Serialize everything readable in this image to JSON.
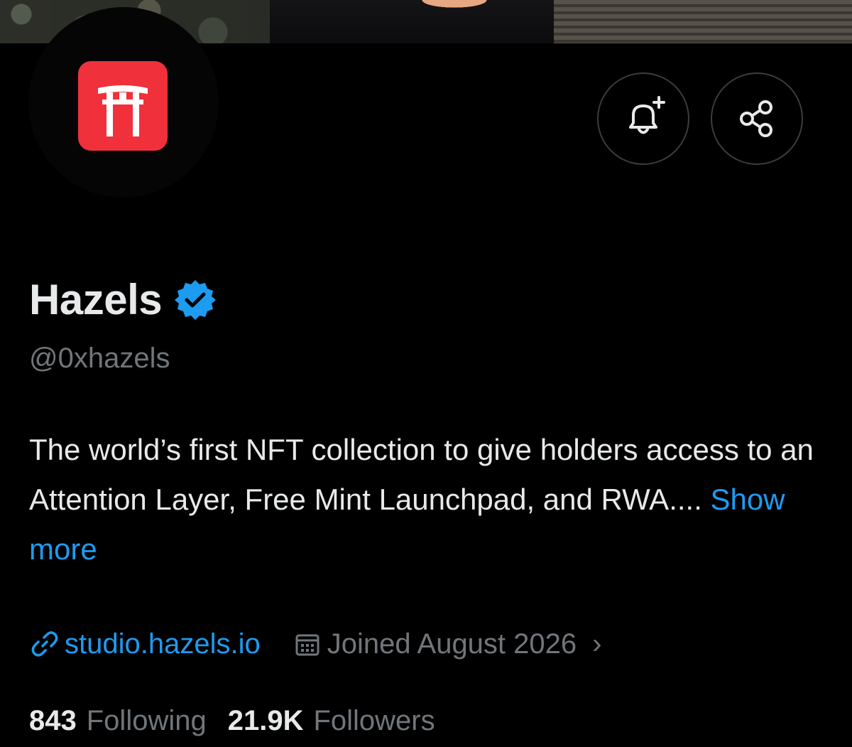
{
  "profile": {
    "display_name": "Hazels",
    "handle": "@0xhazels",
    "verified": true,
    "bio_text": "The world’s first NFT collection to give holders access to an Attention Layer, Free Mint Launchpad, and RWA....",
    "show_more_label": "Show more",
    "website": "studio.hazels.io",
    "joined": "Joined August 2026"
  },
  "stats": {
    "following_count": "843",
    "following_label": "Following",
    "followers_count": "21.9K",
    "followers_label": "Followers"
  },
  "icons": {
    "avatar": "torii-gate-icon",
    "notify": "bell-plus-icon",
    "share": "share-icon",
    "verified": "verified-badge-icon",
    "link": "link-icon",
    "calendar": "calendar-icon",
    "chevron": "chevron-right-icon"
  },
  "colors": {
    "background": "#000000",
    "accent": "#1d9bf0",
    "text_primary": "#e7e9ea",
    "text_secondary": "#71767b",
    "logo_red": "#f0313b"
  }
}
